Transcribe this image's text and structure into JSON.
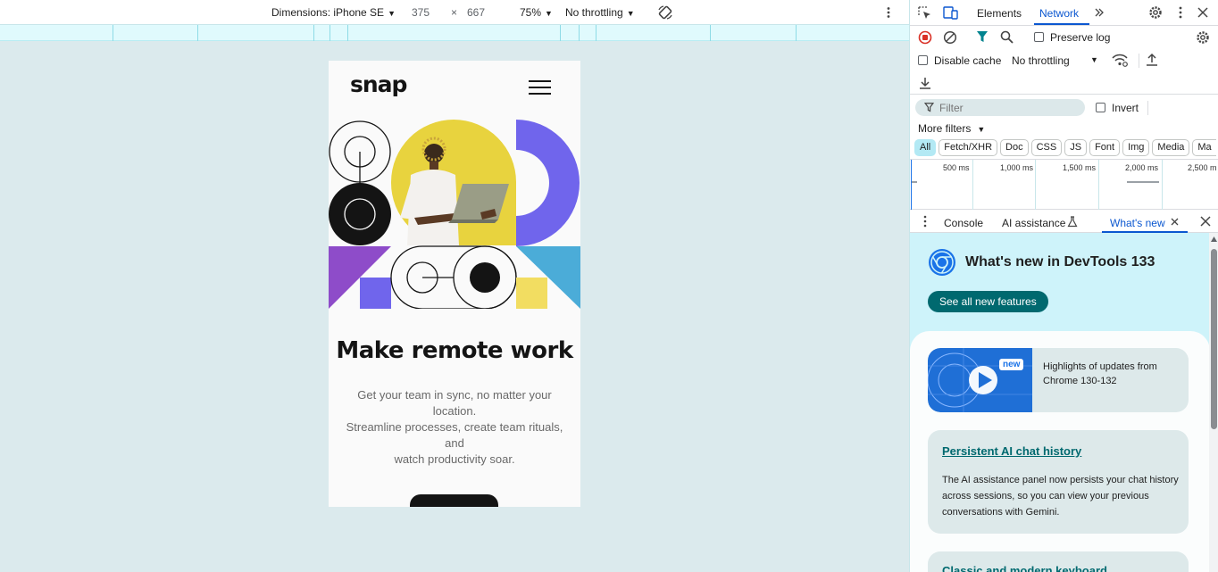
{
  "device_toolbar": {
    "dimensions_label": "Dimensions: iPhone SE",
    "width": "375",
    "times": "×",
    "height": "667",
    "zoom": "75%",
    "throttling": "No throttling"
  },
  "page": {
    "logo": "snap",
    "headline": "Make remote work",
    "subtext_lines": [
      "Get your team in sync, no matter your",
      "location.",
      "Streamline processes, create team rituals,",
      "and",
      "watch productivity soar."
    ],
    "art_colors": {
      "yellow": "#e8d33e",
      "purple": "#7065ec",
      "violet": "#8e4cc9",
      "blue": "#4bacd8",
      "pale_yellow": "#f2dd61",
      "black": "#141414"
    }
  },
  "devtools": {
    "tabs": [
      "Elements",
      "Network"
    ],
    "active_tab": "Network",
    "preserve_log": "Preserve log",
    "disable_cache": "Disable cache",
    "throttling": "No throttling",
    "filter_placeholder": "Filter",
    "invert": "Invert",
    "more_filters": "More filters",
    "type_filters": [
      "All",
      "Fetch/XHR",
      "Doc",
      "CSS",
      "JS",
      "Font",
      "Img",
      "Media",
      "Ma"
    ],
    "timeline_ticks": [
      "500 ms",
      "1,000 ms",
      "1,500 ms",
      "2,000 ms",
      "2,500 m"
    ],
    "drawer": {
      "tabs": [
        "Console",
        "AI assistance",
        "What's new"
      ],
      "active_tab": "What's new",
      "title": "What's new in DevTools 133",
      "see_all": "See all new features",
      "video_badge": "new",
      "video_desc": "Highlights of updates from Chrome 130-132",
      "card1_title": "Persistent AI chat history",
      "card1_body": "The AI assistance panel now persists your chat history across sessions, so you can view your previous conversations with Gemini.",
      "card2_title": "Classic and modern keyboard"
    },
    "accent": "#0b57d0",
    "teal": "#00696f"
  }
}
